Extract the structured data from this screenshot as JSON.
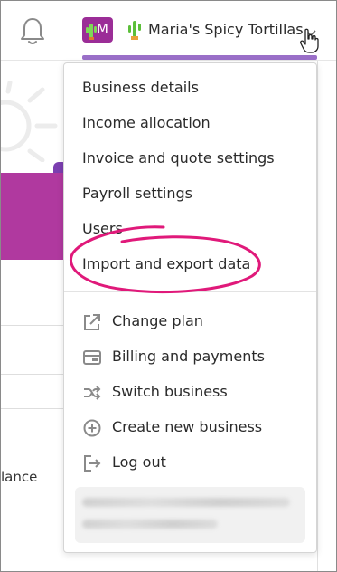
{
  "topbar": {
    "avatar_letter": "M",
    "business_name": "Maria's Spicy Tortillas",
    "accent_color": "#9a6fc8",
    "avatar_color": "#9b2d97"
  },
  "menu": {
    "items": [
      {
        "label": "Business details"
      },
      {
        "label": "Income allocation"
      },
      {
        "label": "Invoice and quote settings"
      },
      {
        "label": "Payroll settings"
      },
      {
        "label": "Users"
      },
      {
        "label": "Import and export data",
        "highlighted": true
      }
    ],
    "action_items": [
      {
        "label": "Change plan",
        "icon": "external-link-icon"
      },
      {
        "label": "Billing and payments",
        "icon": "credit-card-icon"
      },
      {
        "label": "Switch business",
        "icon": "shuffle-icon"
      },
      {
        "label": "Create new business",
        "icon": "plus-circle-icon"
      },
      {
        "label": "Log out",
        "icon": "logout-icon"
      }
    ]
  },
  "background": {
    "balance_text": "lance"
  },
  "annotation_color": "#e0197a"
}
